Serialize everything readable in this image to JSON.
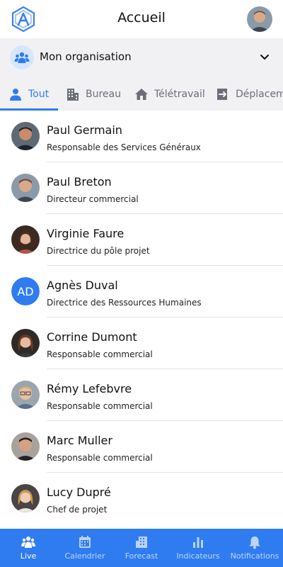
{
  "header": {
    "title": "Accueil"
  },
  "org": {
    "label": "Mon organisation"
  },
  "tabs": [
    {
      "label": "Tout",
      "icon": "person-icon",
      "active": true
    },
    {
      "label": "Bureau",
      "icon": "building-icon"
    },
    {
      "label": "Télétravail",
      "icon": "home-icon"
    },
    {
      "label": "Déplacement",
      "icon": "exit-icon"
    }
  ],
  "people": [
    {
      "name": "Paul Germain",
      "role": "Responsable des Services Généraux"
    },
    {
      "name": "Paul Breton",
      "role": "Directeur commercial"
    },
    {
      "name": "Virginie Faure",
      "role": "Directrice du pôle projet"
    },
    {
      "name": "Agnès Duval",
      "role": "Directrice des Ressources Humaines",
      "initials": "AD"
    },
    {
      "name": "Corrine Dumont",
      "role": "Responsable commercial"
    },
    {
      "name": "Rémy Lefebvre",
      "role": "Responsable commercial"
    },
    {
      "name": "Marc Muller",
      "role": "Responsable commercial"
    },
    {
      "name": "Lucy Dupré",
      "role": "Chef de projet"
    }
  ],
  "nav": [
    {
      "label": "Live",
      "icon": "people-icon",
      "active": true
    },
    {
      "label": "Calendrier",
      "icon": "calendar-icon"
    },
    {
      "label": "Forecast",
      "icon": "forecast-icon"
    },
    {
      "label": "Indicateurs",
      "icon": "bar-chart-icon"
    },
    {
      "label": "Notifications",
      "icon": "bell-icon"
    }
  ],
  "colors": {
    "accent": "#2f7cf0",
    "panel": "#f1f1f4"
  }
}
